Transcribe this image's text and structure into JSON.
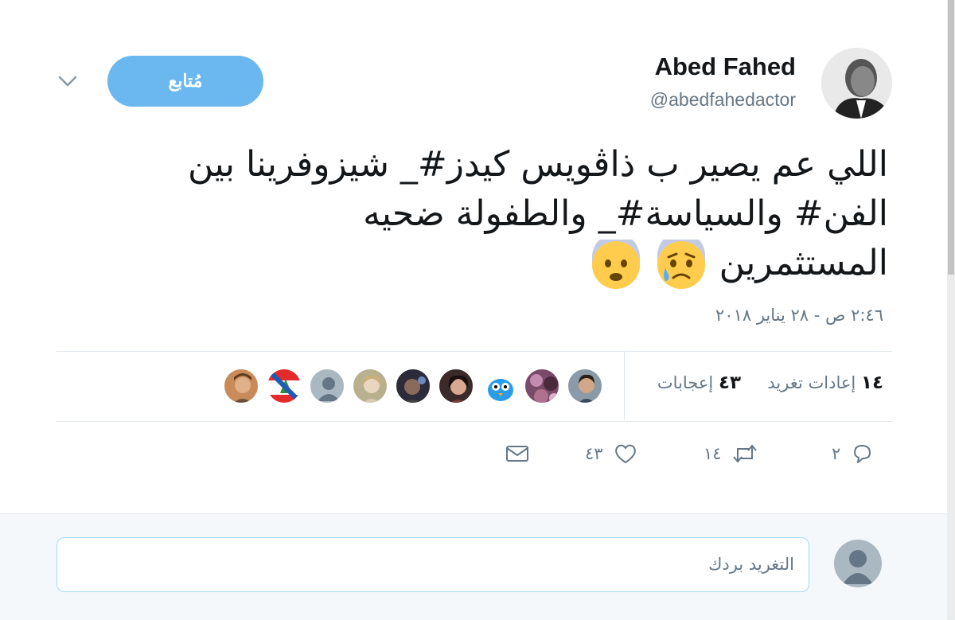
{
  "user": {
    "name": "Abed Fahed",
    "handle": "@abedfahedactor",
    "avatar_icon": "profile-photo"
  },
  "follow_button": {
    "label": "مُتابع"
  },
  "more_icon": "chevron-down-icon",
  "tweet": {
    "line1": "اللي عم يصير ب ذاڤويس كيدز#_ شيزوفرينا بين",
    "line2": "الفن# والسياسة#_    والطفولة ضحيه",
    "line3": "المستثمرين",
    "emojis": [
      "anxious-face-with-sweat",
      "fearful-face"
    ]
  },
  "timestamp": "٢:٤٦ ص - ٢٨ يناير ٢٠١٨",
  "stats": {
    "retweets_count": "١٤",
    "retweets_label": "إعادات تغريد",
    "likes_count": "٤٣",
    "likes_label": "إعجابات"
  },
  "liked_by_avatars": 10,
  "actions": {
    "reply_count": "٢",
    "retweet_count": "١٤",
    "like_count": "٤٣"
  },
  "reply": {
    "placeholder": "التغريد بردك"
  },
  "colors": {
    "accent": "#6bb8f0",
    "text": "#14171a",
    "muted": "#657786",
    "input_border": "#a4d9f9"
  }
}
